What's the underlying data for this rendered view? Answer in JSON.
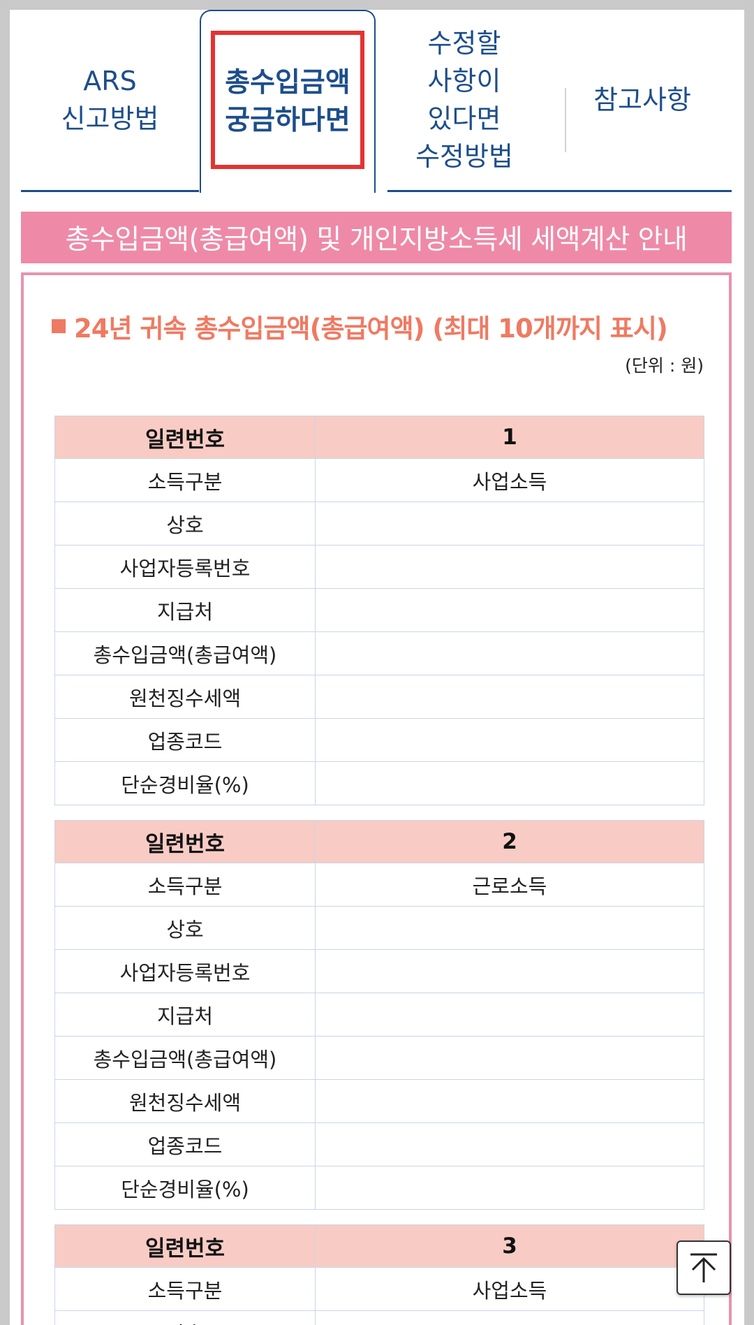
{
  "tabs": [
    {
      "label": "ARS\n신고방법"
    },
    {
      "label": "총수입금액\n궁금하다면",
      "active": true
    },
    {
      "label": "수정할\n사항이\n있다면\n수정방법"
    },
    {
      "label": "참고사항"
    }
  ],
  "banner": {
    "text": "총수입금액(총급여액) 및 개인지방소득세 세액계산 안내"
  },
  "section": {
    "title": "24년 귀속 총수입금액(총급여액) (최대 10개까지 표시)",
    "unit": "(단위 : 원)"
  },
  "table_labels": {
    "serial": "일련번호",
    "income_type": "소득구분",
    "company": "상호",
    "business_no": "사업자등록번호",
    "payer": "지급처",
    "total_income": "총수입금액(총급여액)",
    "withholding": "원천징수세액",
    "industry_code": "업종코드",
    "expense_rate": "단순경비율(%)"
  },
  "records": [
    {
      "serial": "1",
      "income_type": "사업소득"
    },
    {
      "serial": "2",
      "income_type": "근로소득"
    },
    {
      "serial": "3",
      "income_type": "사업소득"
    }
  ],
  "colors": {
    "navy": "#1d4e8a",
    "pink_banner": "#ee8aa8",
    "header_cell": "#f8ccc4",
    "title": "#ef7a62",
    "highlight": "#e53232"
  }
}
